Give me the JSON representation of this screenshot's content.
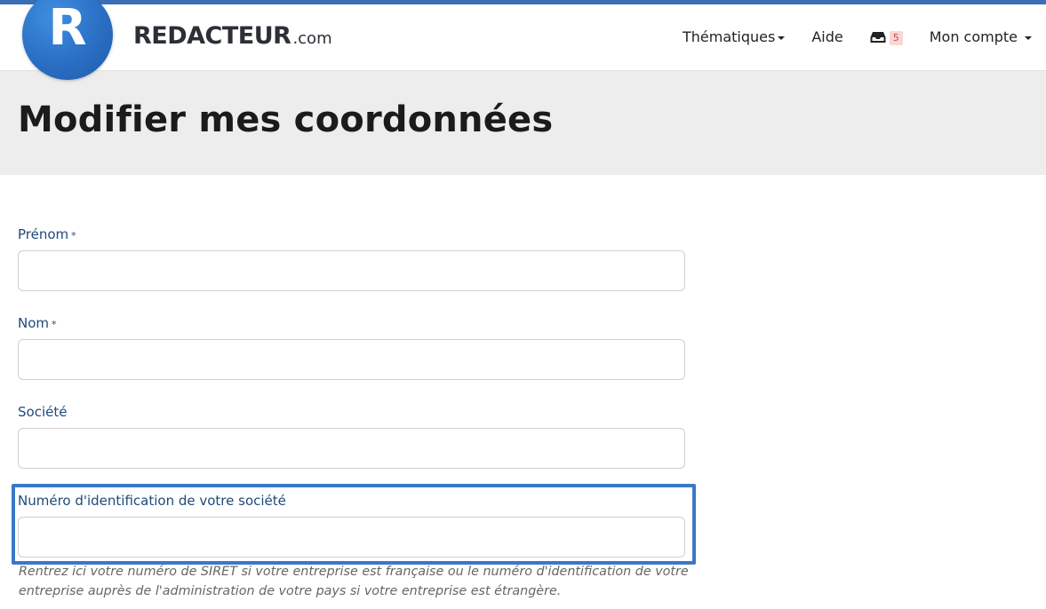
{
  "brand": {
    "logo_letter": "R",
    "name_main": "REDACTEUR",
    "name_suffix": ".com",
    "logo_color": "#2a6fc4"
  },
  "nav": {
    "thematiques_label": "Thématiques",
    "aide_label": "Aide",
    "inbox_icon": "inbox-icon",
    "inbox_count": "5",
    "account_label": "Mon compte"
  },
  "page": {
    "title": "Modifier mes coordonnées"
  },
  "form": {
    "prenom": {
      "label": "Prénom",
      "required_mark": "*",
      "value": ""
    },
    "nom": {
      "label": "Nom",
      "required_mark": "*",
      "value": ""
    },
    "societe": {
      "label": "Société",
      "value": ""
    },
    "numero_identification": {
      "label": "Numéro d'identification de votre société",
      "value": "",
      "help": "Rentrez ici votre numéro de SIRET si votre entreprise est française ou le numéro d'identification de votre entreprise auprès de l'administration de votre pays si votre entreprise est étrangère."
    }
  },
  "colors": {
    "accent": "#3a78c8",
    "label": "#1f4a7a",
    "badge_bg": "#f7d7d7",
    "badge_text": "#d04545"
  }
}
